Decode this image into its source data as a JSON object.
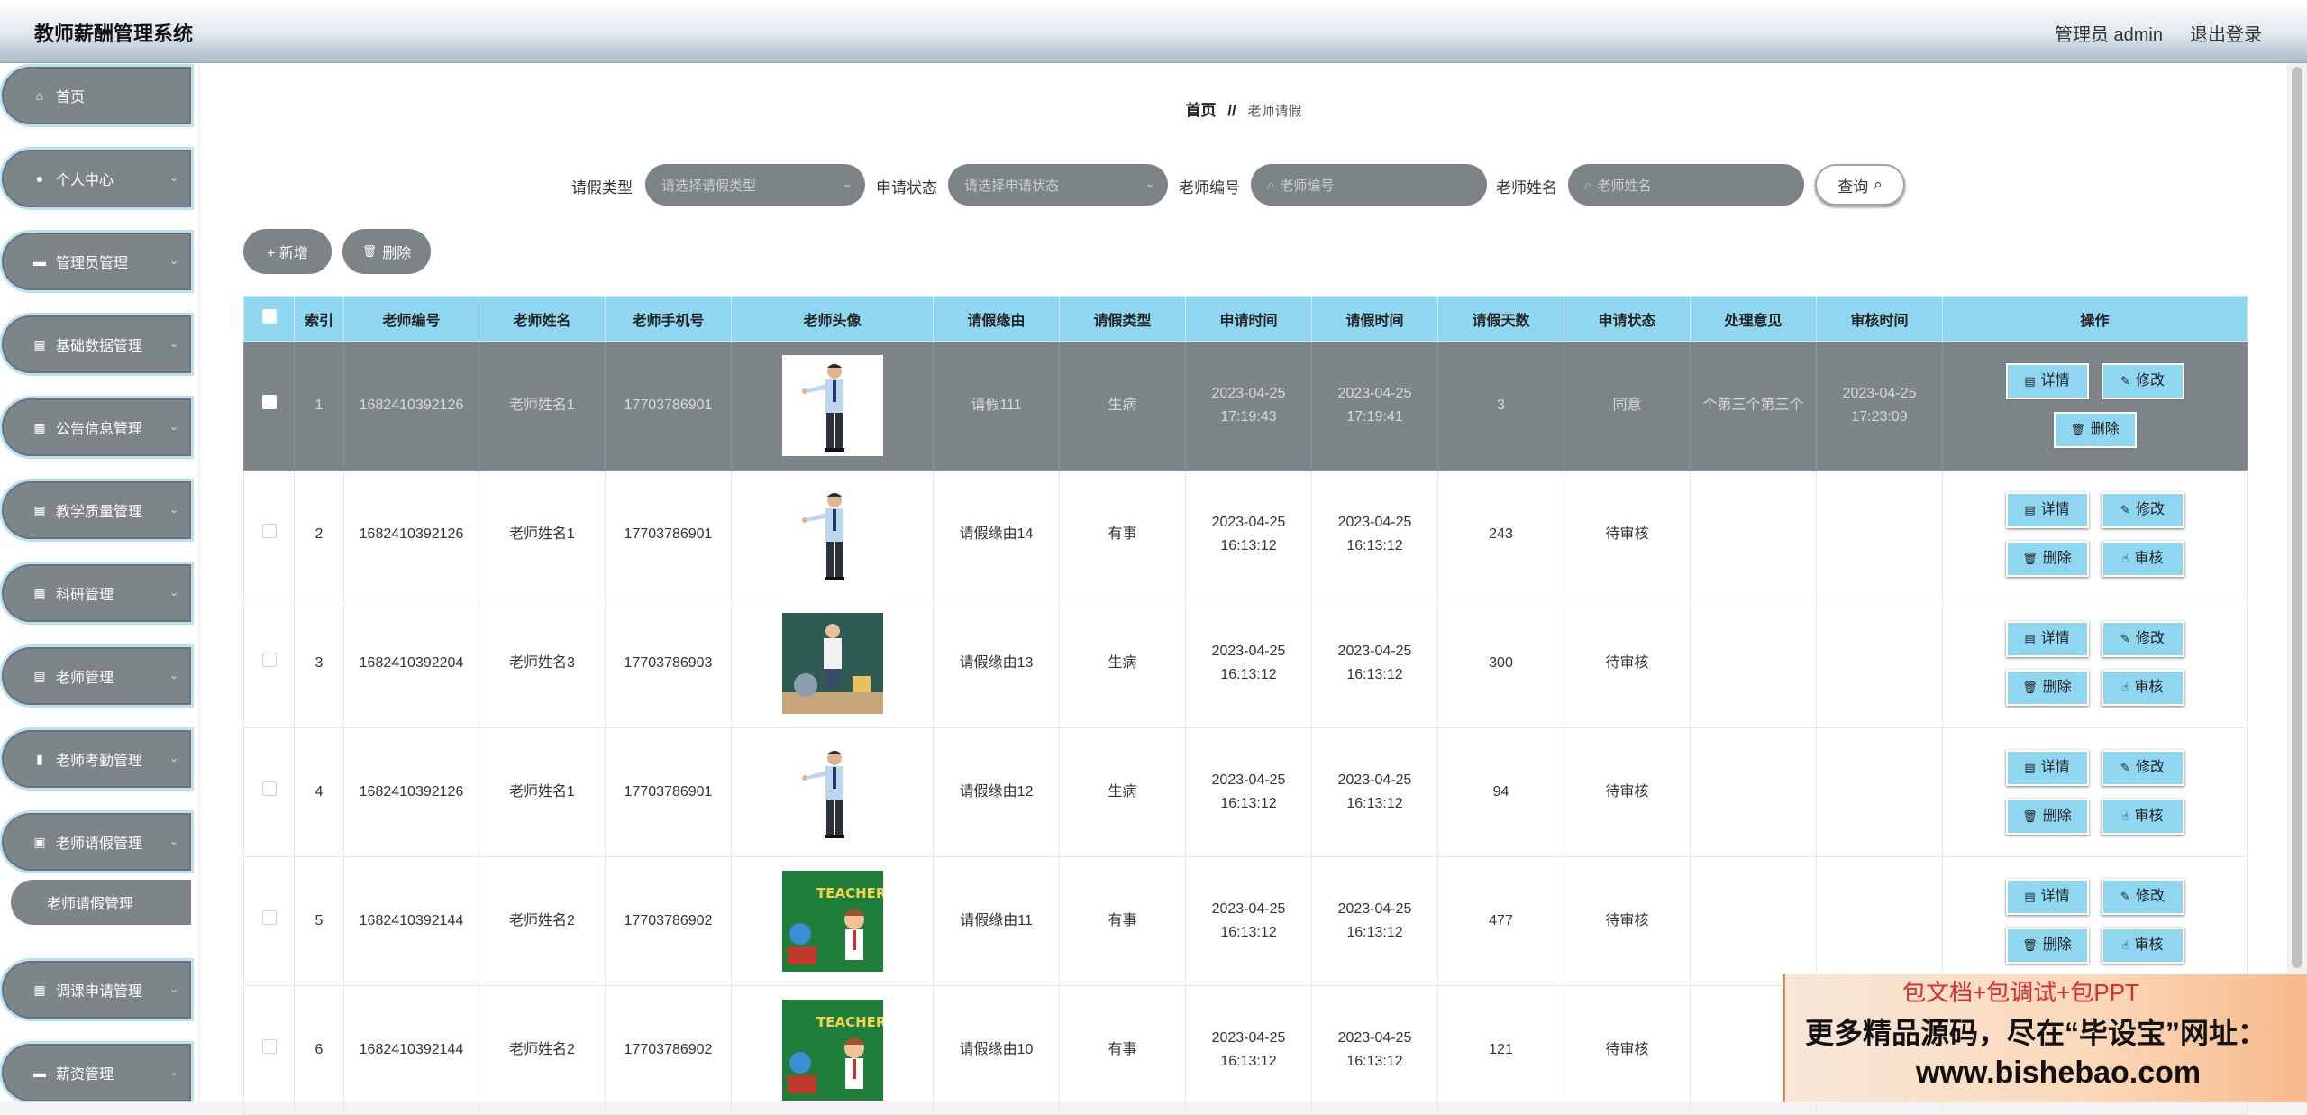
{
  "header": {
    "title": "教师薪酬管理系统",
    "user": "管理员 admin",
    "logout": "退出登录"
  },
  "sidebar": {
    "items": [
      {
        "label": "首页",
        "icon": "home-icon",
        "glyph": "⌂",
        "expandable": false
      },
      {
        "label": "个人中心",
        "icon": "user-icon",
        "glyph": "●",
        "expandable": true
      },
      {
        "label": "管理员管理",
        "icon": "chat-icon",
        "glyph": "▬",
        "expandable": true
      },
      {
        "label": "基础数据管理",
        "icon": "grid-icon",
        "glyph": "▦",
        "expandable": true
      },
      {
        "label": "公告信息管理",
        "icon": "grid-icon",
        "glyph": "▦",
        "expandable": true
      },
      {
        "label": "教学质量管理",
        "icon": "grid-icon",
        "glyph": "▦",
        "expandable": true
      },
      {
        "label": "科研管理",
        "icon": "grid-icon",
        "glyph": "▦",
        "expandable": true
      },
      {
        "label": "老师管理",
        "icon": "briefcase-icon",
        "glyph": "▤",
        "expandable": true
      },
      {
        "label": "老师考勤管理",
        "icon": "bar-chart-icon",
        "glyph": "▮",
        "expandable": true
      },
      {
        "label": "老师请假管理",
        "icon": "clipboard-icon",
        "glyph": "▣",
        "expandable": true
      },
      {
        "label": "调课申请管理",
        "icon": "apps-icon",
        "glyph": "▦",
        "expandable": true
      },
      {
        "label": "薪资管理",
        "icon": "monitor-icon",
        "glyph": "▬",
        "expandable": true
      }
    ],
    "submenu": "老师请假管理"
  },
  "breadcrumb": {
    "home": "首页",
    "sep": "//",
    "current": "老师请假"
  },
  "search": {
    "leave_type_label": "请假类型",
    "leave_type_placeholder": "请选择请假类型",
    "status_label": "申请状态",
    "status_placeholder": "请选择申请状态",
    "teacher_no_label": "老师编号",
    "teacher_no_placeholder": "老师编号",
    "teacher_name_label": "老师姓名",
    "teacher_name_placeholder": "老师姓名",
    "query_button": "查询"
  },
  "actions": {
    "add": "+ 新增",
    "delete": "删除"
  },
  "table": {
    "headers": [
      "索引",
      "老师编号",
      "老师姓名",
      "老师手机号",
      "老师头像",
      "请假缘由",
      "请假类型",
      "申请时间",
      "请假时间",
      "请假天数",
      "申请状态",
      "处理意见",
      "审核时间",
      "操作"
    ],
    "rows": [
      {
        "idx": "1",
        "no": "1682410392126",
        "name": "老师姓名1",
        "phone": "17703786901",
        "reason": "请假111",
        "type": "生病",
        "apply_time": "2023-04-25 17:19:43",
        "leave_time": "2023-04-25 17:19:41",
        "days": "3",
        "status": "同意",
        "opinion": "个第三个第三个",
        "audit_time": "2023-04-25 17:23:09",
        "avatar": "man"
      },
      {
        "idx": "2",
        "no": "1682410392126",
        "name": "老师姓名1",
        "phone": "17703786901",
        "reason": "请假缘由14",
        "type": "有事",
        "apply_time": "2023-04-25 16:13:12",
        "leave_time": "2023-04-25 16:13:12",
        "days": "243",
        "status": "待审核",
        "opinion": "",
        "audit_time": "",
        "avatar": "man"
      },
      {
        "idx": "3",
        "no": "1682410392204",
        "name": "老师姓名3",
        "phone": "17703786903",
        "reason": "请假缘由13",
        "type": "生病",
        "apply_time": "2023-04-25 16:13:12",
        "leave_time": "2023-04-25 16:13:12",
        "days": "300",
        "status": "待审核",
        "opinion": "",
        "audit_time": "",
        "avatar": "classroom"
      },
      {
        "idx": "4",
        "no": "1682410392126",
        "name": "老师姓名1",
        "phone": "17703786901",
        "reason": "请假缘由12",
        "type": "生病",
        "apply_time": "2023-04-25 16:13:12",
        "leave_time": "2023-04-25 16:13:12",
        "days": "94",
        "status": "待审核",
        "opinion": "",
        "audit_time": "",
        "avatar": "man"
      },
      {
        "idx": "5",
        "no": "1682410392144",
        "name": "老师姓名2",
        "phone": "17703786902",
        "reason": "请假缘由11",
        "type": "有事",
        "apply_time": "2023-04-25 16:13:12",
        "leave_time": "2023-04-25 16:13:12",
        "days": "477",
        "status": "待审核",
        "opinion": "",
        "audit_time": "",
        "avatar": "poster"
      },
      {
        "idx": "6",
        "no": "1682410392144",
        "name": "老师姓名2",
        "phone": "17703786902",
        "reason": "请假缘由10",
        "type": "有事",
        "apply_time": "2023-04-25 16:13:12",
        "leave_time": "2023-04-25 16:13:12",
        "days": "121",
        "status": "待审核",
        "opinion": "",
        "audit_time": "",
        "avatar": "poster"
      }
    ],
    "op_labels": {
      "detail": "详情",
      "edit": "修改",
      "delete": "删除",
      "audit": "审核"
    },
    "poster_text": "TEACHER'S"
  },
  "ad": {
    "line1": "包文档+包调试+包PPT",
    "line2": "更多精品源码，尽在“毕设宝”网址：",
    "line3": "www.bishebao.com"
  },
  "colors": {
    "accent": "#8fd6f1",
    "sidebar": "#7e8589",
    "selected_row": "#7e8589"
  }
}
